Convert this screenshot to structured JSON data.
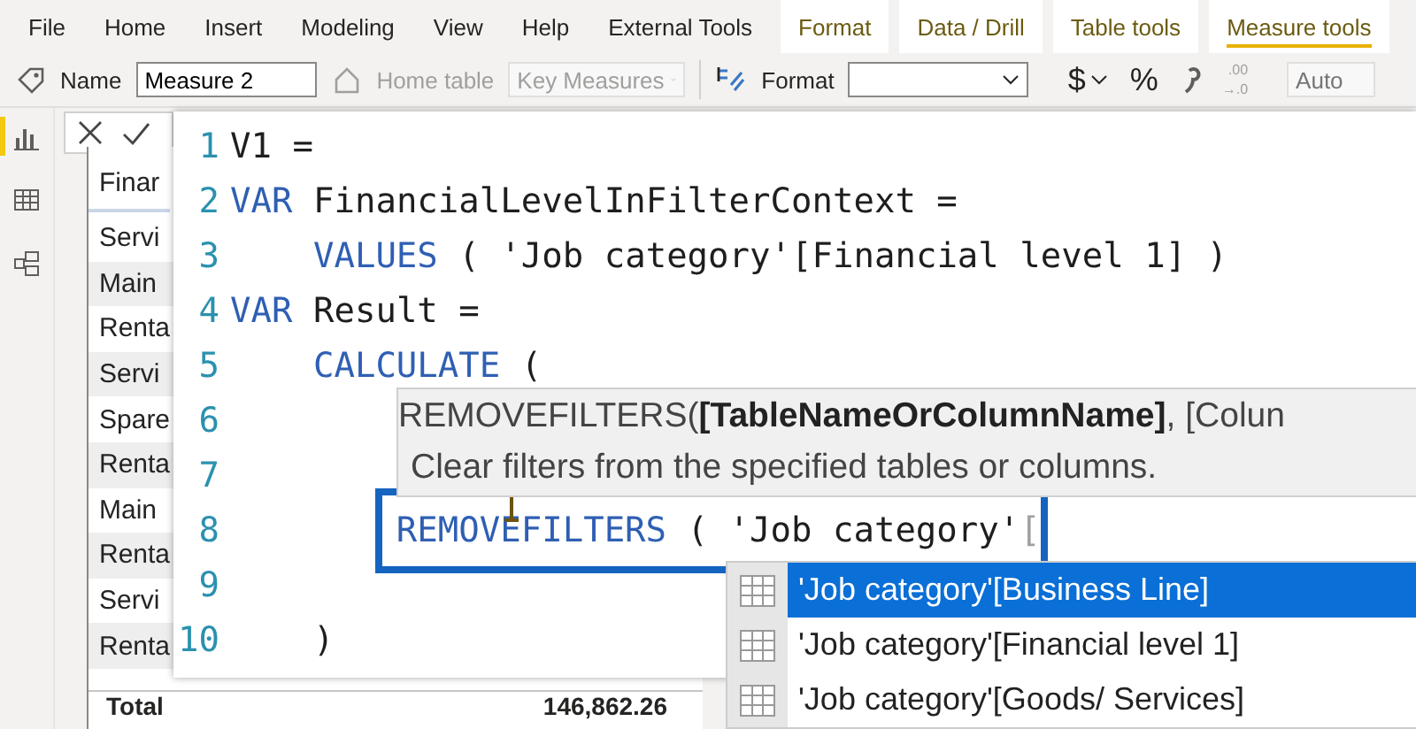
{
  "menu": [
    {
      "label": "File",
      "kind": "main",
      "selected": false
    },
    {
      "label": "Home",
      "kind": "main",
      "selected": false
    },
    {
      "label": "Insert",
      "kind": "main",
      "selected": false
    },
    {
      "label": "Modeling",
      "kind": "main",
      "selected": false
    },
    {
      "label": "View",
      "kind": "main",
      "selected": false
    },
    {
      "label": "Help",
      "kind": "main",
      "selected": false
    },
    {
      "label": "External Tools",
      "kind": "main",
      "selected": false
    },
    {
      "label": "Format",
      "kind": "contextual",
      "selected": false
    },
    {
      "label": "Data / Drill",
      "kind": "contextual",
      "selected": false
    },
    {
      "label": "Table tools",
      "kind": "contextual",
      "selected": false
    },
    {
      "label": "Measure tools",
      "kind": "contextual",
      "selected": true
    }
  ],
  "toolbar": {
    "name_label": "Name",
    "name_value": "Measure 2",
    "home_table": {
      "label": "Home table",
      "value": "Key Measures",
      "disabled": true
    },
    "format": {
      "label": "Format"
    },
    "currency": "$",
    "percent": "%",
    "decimal_top": ".00",
    "decimal_bottom": "→.0",
    "auto": {
      "placeholder": "Auto",
      "disabled": true
    }
  },
  "rail": [
    {
      "kind": "report",
      "selected": true
    },
    {
      "kind": "data",
      "selected": false
    },
    {
      "kind": "model",
      "selected": false
    }
  ],
  "table": {
    "header": "Finar",
    "rows": [
      "Servi",
      "Main",
      "Renta",
      "Servi",
      "Spare",
      "Renta",
      "Main",
      "Renta",
      "Servi",
      "Renta"
    ],
    "total_label": "Total",
    "total_value": "146,862.26"
  },
  "editor": {
    "lines": [
      {
        "number": "1",
        "highlighted": false,
        "tokens": [
          {
            "kind": "plain",
            "text": "V1 ="
          }
        ]
      },
      {
        "number": "2",
        "highlighted": false,
        "tokens": [
          {
            "kind": "keyword",
            "text": "VAR"
          },
          {
            "kind": "plain",
            "text": " FinancialLevelInFilterContext ="
          }
        ]
      },
      {
        "number": "3",
        "highlighted": false,
        "tokens": [
          {
            "kind": "keyword",
            "text": "    VALUES"
          },
          {
            "kind": "plain",
            "text": " ( 'Job category'[Financial level 1] )"
          }
        ]
      },
      {
        "number": "4",
        "highlighted": false,
        "tokens": [
          {
            "kind": "keyword",
            "text": "VAR"
          },
          {
            "kind": "plain",
            "text": " Result ="
          }
        ]
      },
      {
        "number": "5",
        "highlighted": false,
        "tokens": [
          {
            "kind": "keyword",
            "text": "    CALCULATE"
          },
          {
            "kind": "plain",
            "text": " ("
          }
        ]
      },
      {
        "number": "6",
        "highlighted": false
      },
      {
        "number": "7",
        "highlighted": false
      },
      {
        "number": "8",
        "highlighted": true,
        "tokens": [
          {
            "kind": "keyword",
            "text": "        REMOVEFILTERS"
          },
          {
            "kind": "plain",
            "text": " ( 'Job category'"
          },
          {
            "kind": "muted",
            "text": "["
          }
        ]
      },
      {
        "number": "9",
        "highlighted": false
      },
      {
        "number": "10",
        "highlighted": false,
        "tokens": [
          {
            "kind": "plain",
            "text": "    )"
          }
        ]
      }
    ]
  },
  "tooltip": {
    "signature": "REMOVEFILTERS(**[TableNameOrColumnName]**, [Colun",
    "description": "Clear filters from the specified tables or columns."
  },
  "autocomplete": [
    {
      "text": "'Job category'[Business Line]",
      "selected": true
    },
    {
      "text": "'Job category'[Financial level 1]",
      "selected": false
    },
    {
      "text": "'Job category'[Goods/ Services]",
      "selected": false
    }
  ]
}
